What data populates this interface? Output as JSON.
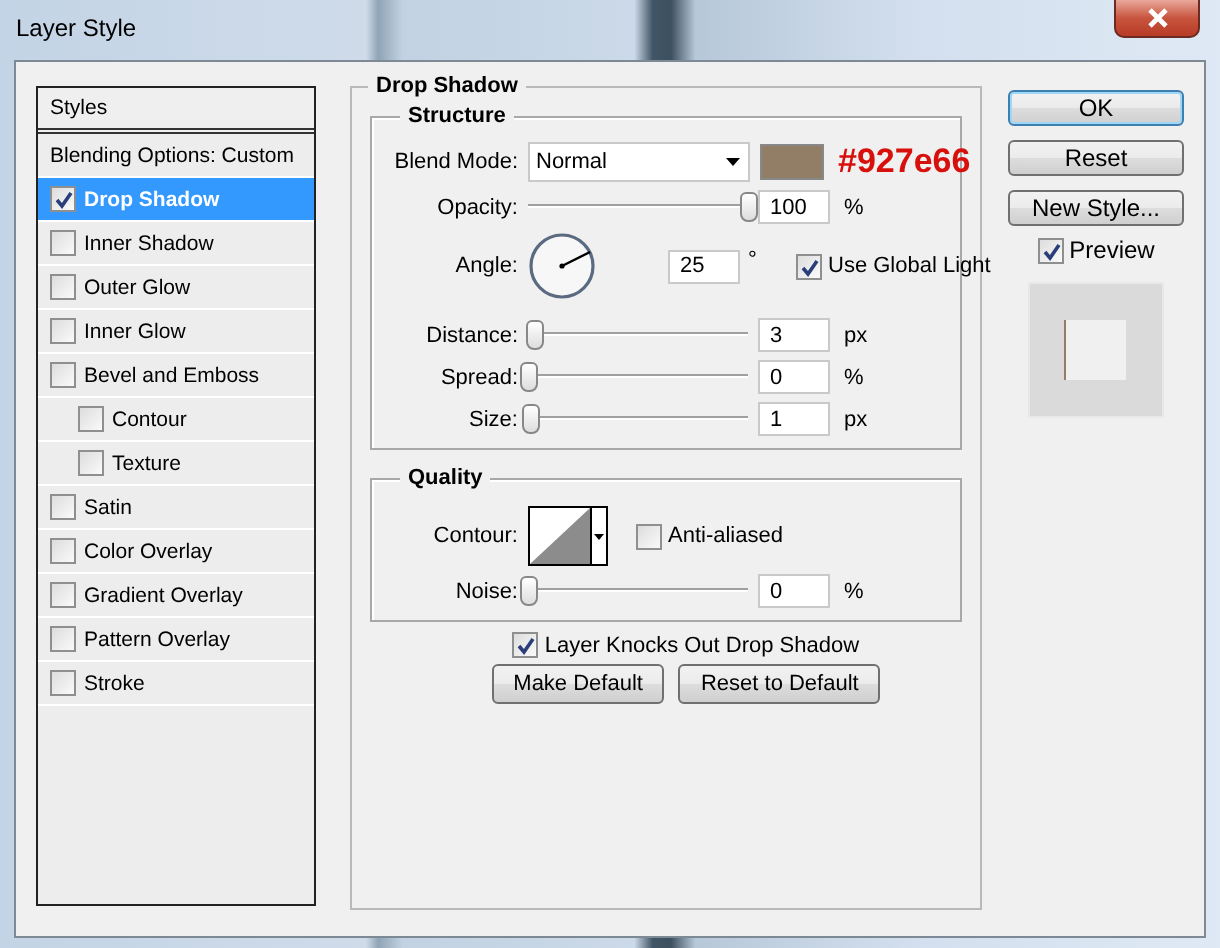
{
  "window": {
    "title": "Layer Style"
  },
  "sidebar": {
    "items": [
      {
        "kind": "heading",
        "label": "Styles",
        "selected": false
      },
      {
        "kind": "plain",
        "label": "Blending Options: Custom",
        "selected": false
      },
      {
        "kind": "effect",
        "label": "Drop Shadow",
        "checked": true,
        "selected": true
      },
      {
        "kind": "effect",
        "label": "Inner Shadow",
        "checked": false,
        "selected": false
      },
      {
        "kind": "effect",
        "label": "Outer Glow",
        "checked": false,
        "selected": false
      },
      {
        "kind": "effect",
        "label": "Inner Glow",
        "checked": false,
        "selected": false
      },
      {
        "kind": "effect",
        "label": "Bevel and Emboss",
        "checked": false,
        "selected": false,
        "children": [
          {
            "kind": "effect",
            "label": "Contour",
            "checked": false,
            "selected": false
          },
          {
            "kind": "effect",
            "label": "Texture",
            "checked": false,
            "selected": false
          }
        ]
      },
      {
        "kind": "effect",
        "label": "Satin",
        "checked": false,
        "selected": false
      },
      {
        "kind": "effect",
        "label": "Color Overlay",
        "checked": false,
        "selected": false
      },
      {
        "kind": "effect",
        "label": "Gradient Overlay",
        "checked": false,
        "selected": false
      },
      {
        "kind": "effect",
        "label": "Pattern Overlay",
        "checked": false,
        "selected": false
      },
      {
        "kind": "effect",
        "label": "Stroke",
        "checked": false,
        "selected": false
      }
    ]
  },
  "drop_shadow": {
    "title": "Drop Shadow",
    "structure": {
      "title": "Structure",
      "blend_mode": {
        "label": "Blend Mode:",
        "value": "Normal"
      },
      "shadow_color": {
        "color": "#927e66",
        "annotation": "#927e66"
      },
      "opacity": {
        "label": "Opacity:",
        "level": 1,
        "value": "100",
        "unit": "%"
      },
      "angle": {
        "label": "Angle:",
        "value": "25",
        "unit": "°"
      },
      "use_global_light": {
        "label": "Use Global Light",
        "checked": true
      },
      "distance": {
        "label": "Distance:",
        "level": 0.03,
        "value": "3",
        "unit": "px"
      },
      "spread": {
        "label": "Spread:",
        "level": 0,
        "value": "0",
        "unit": "%"
      },
      "size": {
        "label": "Size:",
        "level": 0.01,
        "value": "1",
        "unit": "px"
      }
    },
    "quality": {
      "title": "Quality",
      "contour": {
        "label": "Contour:"
      },
      "anti_aliased": {
        "label": "Anti-aliased",
        "checked": false
      },
      "noise": {
        "label": "Noise:",
        "level": 0,
        "value": "0",
        "unit": "%"
      }
    },
    "layer_knocks_out": {
      "label": "Layer Knocks Out Drop Shadow",
      "checked": true
    },
    "buttons": [
      "Make Default",
      "Reset to Default"
    ]
  },
  "buttons": [
    {
      "label": "OK",
      "default": true
    },
    {
      "label": "Reset",
      "default": false
    },
    {
      "label": "New Style...",
      "default": false
    }
  ],
  "preview": {
    "label": "Preview",
    "checked": true
  }
}
